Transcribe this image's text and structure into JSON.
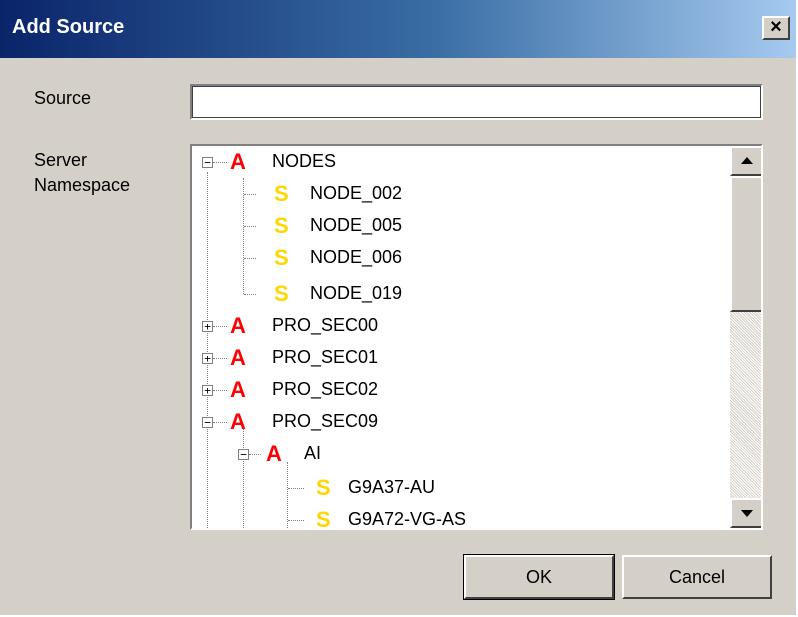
{
  "window": {
    "title": "Add Source",
    "close_label": "×"
  },
  "form": {
    "source_label": "Source",
    "source_value": "",
    "namespace_label_line1": "Server",
    "namespace_label_line2": "Namespace"
  },
  "tree": {
    "items": [
      {
        "label": "NODES",
        "icon": "A"
      },
      {
        "label": "NODE_002",
        "icon": "S"
      },
      {
        "label": "NODE_005",
        "icon": "S"
      },
      {
        "label": "NODE_006",
        "icon": "S"
      },
      {
        "label": "NODE_019",
        "icon": "S"
      },
      {
        "label": "PRO_SEC00",
        "icon": "A"
      },
      {
        "label": "PRO_SEC01",
        "icon": "A"
      },
      {
        "label": "PRO_SEC02",
        "icon": "A"
      },
      {
        "label": "PRO_SEC09",
        "icon": "A"
      },
      {
        "label": "AI",
        "icon": "A"
      },
      {
        "label": "G9A37-AU",
        "icon": "S"
      },
      {
        "label": "G9A72-VG-AS",
        "icon": "S"
      }
    ],
    "expander_expanded": "−",
    "expander_collapsed": "+"
  },
  "buttons": {
    "ok_label": "OK",
    "cancel_label": "Cancel"
  },
  "colors": {
    "titlebar_start": "#0a246a",
    "titlebar_end": "#a6caf0",
    "dialog_bg": "#d4d0c8",
    "icon_a": "#ff0000",
    "icon_s": "#ffd700"
  }
}
